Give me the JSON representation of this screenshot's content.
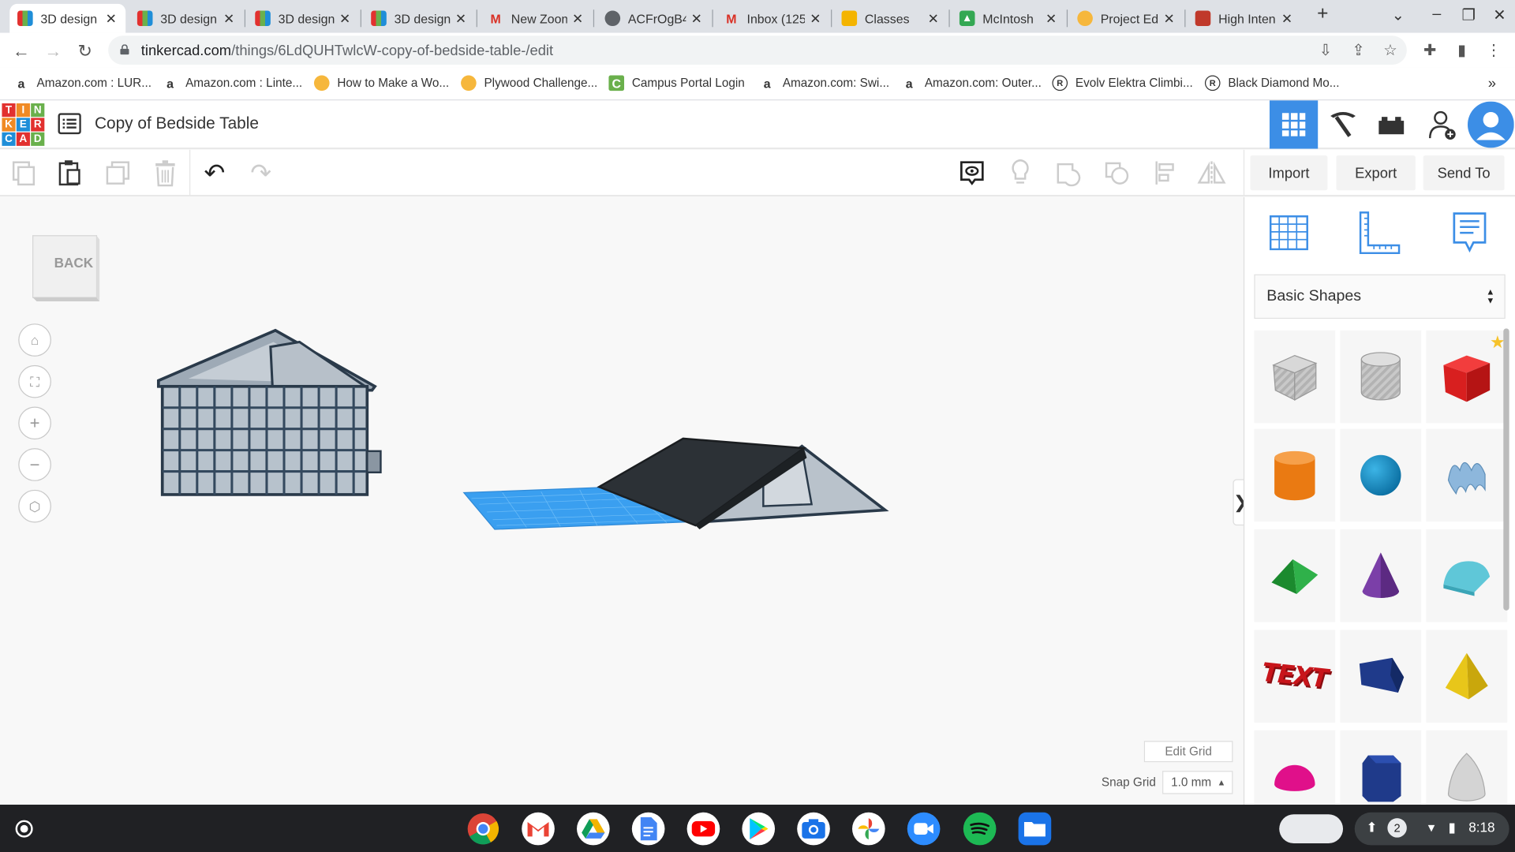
{
  "browser": {
    "tabs": [
      {
        "title": "3D design",
        "icon": "tinkercad-icon",
        "active": true
      },
      {
        "title": "3D design",
        "icon": "tinkercad-icon"
      },
      {
        "title": "3D design",
        "icon": "tinkercad-icon"
      },
      {
        "title": "3D design",
        "icon": "tinkercad-icon"
      },
      {
        "title": "New Zoom",
        "icon": "gmail-icon"
      },
      {
        "title": "ACFrOgB4",
        "icon": "globe-icon"
      },
      {
        "title": "Inbox (125",
        "icon": "gmail-icon"
      },
      {
        "title": "Classes",
        "icon": "classroom-icon"
      },
      {
        "title": "McIntosh",
        "icon": "project-icon"
      },
      {
        "title": "Project Ed",
        "icon": "instructables-icon"
      },
      {
        "title": "High Inten",
        "icon": "image-icon"
      }
    ],
    "new_tab_label": "+",
    "url_host": "tinkercad.com",
    "url_path": "/things/6LdQUHTwlcW-copy-of-bedside-table-/edit",
    "bookmarks": [
      {
        "label": "Amazon.com : LUR...",
        "icon": "amazon-icon"
      },
      {
        "label": "Amazon.com : Linte...",
        "icon": "amazon-icon"
      },
      {
        "label": "How to Make a Wo...",
        "icon": "instructables-icon"
      },
      {
        "label": "Plywood Challenge...",
        "icon": "instructables-icon"
      },
      {
        "label": "Campus Portal Login",
        "icon": "campus-icon"
      },
      {
        "label": "Amazon.com: Swi...",
        "icon": "amazon-icon"
      },
      {
        "label": "Amazon.com: Outer...",
        "icon": "amazon-icon"
      },
      {
        "label": "Evolv Elektra Climbi...",
        "icon": "evolv-icon"
      },
      {
        "label": "Black Diamond Mo...",
        "icon": "evolv-icon"
      }
    ],
    "bookmarks_more": "»"
  },
  "app": {
    "logo_letters": [
      "T",
      "I",
      "N",
      "K",
      "E",
      "R",
      "C",
      "A",
      "D"
    ],
    "logo_colors": [
      "#e2312f",
      "#f08a24",
      "#6ab04c",
      "#f08a24",
      "#1f8ed8",
      "#e2312f",
      "#1f8ed8",
      "#e2312f",
      "#6ab04c"
    ],
    "doc_title": "Copy of Bedside Table",
    "import_label": "Import",
    "export_label": "Export",
    "send_to_label": "Send To",
    "viewcube_label": "BACK",
    "edit_grid_label": "Edit Grid",
    "snap_grid_label": "Snap Grid",
    "snap_grid_value": "1.0 mm",
    "shape_category": "Basic Shapes",
    "panel_collapse": "❯",
    "accent": "#3c8ee6"
  },
  "shapes": [
    {
      "name": "box-hole"
    },
    {
      "name": "cylinder-hole"
    },
    {
      "name": "box"
    },
    {
      "name": "cylinder"
    },
    {
      "name": "sphere"
    },
    {
      "name": "scribble"
    },
    {
      "name": "roof"
    },
    {
      "name": "cone"
    },
    {
      "name": "round-roof"
    },
    {
      "name": "text",
      "label": "TEXT"
    },
    {
      "name": "wedge"
    },
    {
      "name": "pyramid"
    },
    {
      "name": "half-sphere"
    },
    {
      "name": "polygon"
    },
    {
      "name": "paraboloid"
    }
  ],
  "taskbar": {
    "time": "8:18",
    "notification_count": "2",
    "apps": [
      "chrome-icon",
      "gmail-icon",
      "drive-icon",
      "docs-icon",
      "youtube-icon",
      "play-store-icon",
      "camera-icon",
      "photos-icon",
      "zoom-icon",
      "spotify-icon",
      "files-icon"
    ]
  }
}
